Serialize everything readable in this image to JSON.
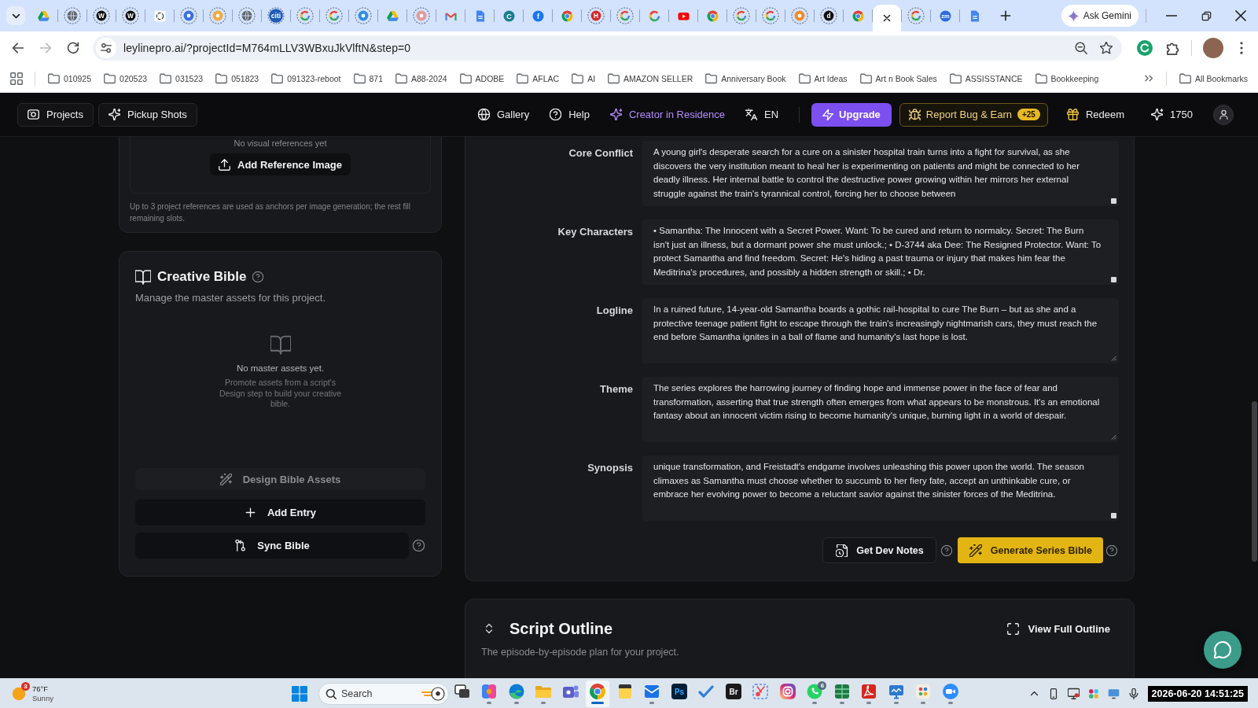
{
  "browser": {
    "tabs": [
      {
        "kind": "drive",
        "discarded": false,
        "selected": false
      },
      {
        "kind": "globe",
        "discarded": true,
        "selected": false
      },
      {
        "kind": "letter",
        "label": "W",
        "color": "#111111",
        "discarded": true,
        "selected": false
      },
      {
        "kind": "letter",
        "label": "W",
        "color": "#111111",
        "discarded": true,
        "selected": false
      },
      {
        "kind": "swirl",
        "discarded": false,
        "selected": false
      },
      {
        "kind": "circle",
        "color": "#3b6fe0",
        "discarded": true,
        "selected": false
      },
      {
        "kind": "circle",
        "color": "#f2a93b",
        "discarded": true,
        "selected": false
      },
      {
        "kind": "globe",
        "discarded": true,
        "selected": false
      },
      {
        "kind": "wordmark",
        "label": "citi",
        "color": "#1e5bb8",
        "discarded": true,
        "selected": false
      },
      {
        "kind": "google",
        "discarded": true,
        "selected": false
      },
      {
        "kind": "google",
        "discarded": true,
        "selected": false
      },
      {
        "kind": "circle",
        "color": "#2f8fe0",
        "discarded": true,
        "selected": false
      },
      {
        "kind": "drive",
        "discarded": false,
        "selected": false
      },
      {
        "kind": "circle",
        "color": "#e39a9a",
        "discarded": true,
        "selected": false
      },
      {
        "kind": "mail",
        "discarded": false,
        "selected": false
      },
      {
        "kind": "doc",
        "discarded": false,
        "selected": false
      },
      {
        "kind": "letter",
        "label": "C",
        "color": "#1a7f8e",
        "discarded": false,
        "selected": false
      },
      {
        "kind": "letter",
        "label": "f",
        "color": "#1877f2",
        "discarded": false,
        "selected": false
      },
      {
        "kind": "chrome",
        "discarded": false,
        "selected": false
      },
      {
        "kind": "letter",
        "label": "H",
        "color": "#d62828",
        "discarded": true,
        "selected": false
      },
      {
        "kind": "google",
        "discarded": true,
        "selected": false
      },
      {
        "kind": "google",
        "discarded": false,
        "selected": false
      },
      {
        "kind": "youtube",
        "discarded": false,
        "selected": false
      },
      {
        "kind": "chrome",
        "discarded": false,
        "selected": false
      },
      {
        "kind": "google",
        "discarded": true,
        "selected": false
      },
      {
        "kind": "google",
        "discarded": true,
        "selected": false
      },
      {
        "kind": "circle",
        "color": "#f28c28",
        "discarded": true,
        "selected": false
      },
      {
        "kind": "letter",
        "label": "d",
        "color": "#111111",
        "discarded": true,
        "selected": false
      },
      {
        "kind": "chrome",
        "discarded": false,
        "selected": false
      },
      {
        "selected": true
      },
      {
        "kind": "google",
        "discarded": true,
        "selected": false
      },
      {
        "kind": "letter",
        "label": "zm",
        "color": "#2d6cdf",
        "discarded": false,
        "selected": false
      },
      {
        "kind": "doc",
        "discarded": false,
        "selected": false
      }
    ],
    "ask_button": "Ask Gemini",
    "nav": [
      {
        "kind": "back",
        "disabled": false
      },
      {
        "kind": "forward",
        "disabled": true
      },
      {
        "kind": "reload",
        "disabled": false
      }
    ],
    "url": "leylinepro.ai/?projectId=M764mLLV3WBxuJkVlftN&step=0",
    "bookmarks": [
      "010925",
      "020523",
      "031523",
      "051823",
      "091323-reboot",
      "871",
      "A88-2024",
      "ADOBE",
      "AFLAC",
      "AI",
      "AMAZON SELLER",
      "Anniversary Book",
      "Art Ideas",
      "Art n Book Sales",
      "ASSISSTANCE",
      "Bookkeeping"
    ],
    "all_bookmarks": "All Bookmarks"
  },
  "app_header": {
    "left_buttons": [
      {
        "kind": "projects",
        "label": "Projects"
      },
      {
        "kind": "pickup",
        "label": "Pickup Shots"
      }
    ],
    "links": [
      {
        "kind": "gallery",
        "label": "Gallery"
      },
      {
        "kind": "help",
        "label": "Help"
      },
      {
        "kind": "creator",
        "label": "Creator in Residence"
      },
      {
        "kind": "language",
        "label": "EN"
      }
    ],
    "upgrade": "Upgrade",
    "report": {
      "label": "Report Bug & Earn",
      "badge": "+25"
    },
    "redeem": "Redeem",
    "credits": "1750"
  },
  "references": {
    "empty_text": "No visual references yet",
    "button": "Add Reference Image",
    "note": "Up to 3 project references are used as anchors per image generation; the rest fill remaining slots."
  },
  "creative_bible": {
    "title": "Creative Bible",
    "subtitle": "Manage the master assets for this project.",
    "empty_title": "No master assets yet.",
    "empty_text": "Promote assets from a script's Design step to build your creative bible.",
    "actions": [
      {
        "kind": "design",
        "label": "Design Bible Assets",
        "disabled": true
      },
      {
        "kind": "add",
        "label": "Add Entry",
        "disabled": false
      },
      {
        "kind": "sync",
        "label": "Sync Bible",
        "disabled": false
      }
    ]
  },
  "series_bible": {
    "fields": [
      {
        "label": "Core Conflict",
        "value": "A young girl's desperate search for a cure on a sinister hospital train turns into a fight for survival, as she discovers the very institution meant to heal her is experimenting on patients and might be connected to her deadly illness. Her internal battle to control the destructive power growing within her mirrors her external struggle against the train's tyrannical control, forcing her to choose between",
        "overflowing": true
      },
      {
        "label": "Key Characters",
        "value": "• Samantha: The Innocent with a Secret Power. Want: To be cured and return to normalcy. Secret: The Burn isn't just an illness, but a dormant power she must unlock.; • D-3744 aka Dee: The Resigned Protector. Want: To protect Samantha and find freedom. Secret: He's hiding a past trauma or injury that makes him fear the Meditrina's procedures, and possibly a hidden strength or skill.; • Dr.",
        "overflowing": true
      },
      {
        "label": "Logline",
        "value": "In a ruined future, 14-year-old Samantha boards a gothic rail-hospital to cure The Burn – but as she and a protective teenage patient fight to escape through the train's increasingly nightmarish cars, they must reach the end before Samantha ignites in a ball of flame and humanity's last hope is lost.",
        "overflowing": false
      },
      {
        "label": "Theme",
        "value": "The series explores the harrowing journey of finding hope and immense power in the face of fear and transformation, asserting that true strength often emerges from what appears to be monstrous. It's an emotional fantasy about an innocent victim rising to become humanity's unique, burning light in a world of despair.",
        "overflowing": false
      },
      {
        "label": "Synopsis",
        "value": "unique transformation, and Freistadt's endgame involves unleashing this power upon the world. The season climaxes as Samantha must choose whether to succumb to her fiery fate, accept an unthinkable cure, or embrace her evolving power to become a reluctant savior against the sinister forces of the Meditrina.",
        "overflowing": true
      }
    ],
    "actions": [
      {
        "kind": "notes",
        "label": "Get Dev Notes"
      },
      {
        "kind": "generate",
        "label": "Generate Series Bible"
      }
    ]
  },
  "script_outline": {
    "title": "Script Outline",
    "subtitle": "The episode-by-episode plan for your project.",
    "view_button": "View Full Outline"
  },
  "taskbar": {
    "weather": {
      "temperature": "76°F",
      "condition": "Sunny",
      "badge": "3"
    },
    "search": {
      "placeholder": "Search"
    },
    "apps": [
      {
        "kind": "taskview",
        "running": false,
        "active": false
      },
      {
        "kind": "copilot",
        "running": true,
        "active": false
      },
      {
        "kind": "edge",
        "running": true,
        "active": false
      },
      {
        "kind": "folder",
        "running": true,
        "active": false
      },
      {
        "kind": "teams",
        "running": false,
        "active": false
      },
      {
        "kind": "chrome",
        "running": true,
        "active": true
      },
      {
        "kind": "sticky",
        "running": false,
        "active": false
      },
      {
        "kind": "mail",
        "running": true,
        "active": false
      },
      {
        "kind": "ps",
        "label": "Ps",
        "running": false,
        "active": false
      },
      {
        "kind": "todo",
        "running": false,
        "active": false
      },
      {
        "kind": "br",
        "label": "Br",
        "running": false,
        "active": false
      },
      {
        "kind": "snip",
        "running": false,
        "active": false
      },
      {
        "kind": "instagram",
        "running": false,
        "active": false
      },
      {
        "kind": "whatsapp",
        "badge": "6",
        "running": true,
        "active": false
      },
      {
        "kind": "excel",
        "running": true,
        "active": false
      },
      {
        "kind": "acrobat",
        "running": true,
        "active": false
      },
      {
        "kind": "monitor",
        "running": true,
        "active": false
      },
      {
        "kind": "paint",
        "running": true,
        "active": false
      },
      {
        "kind": "zoom",
        "running": true,
        "active": false
      }
    ],
    "clock": "2026-06-20 14:51:25"
  }
}
